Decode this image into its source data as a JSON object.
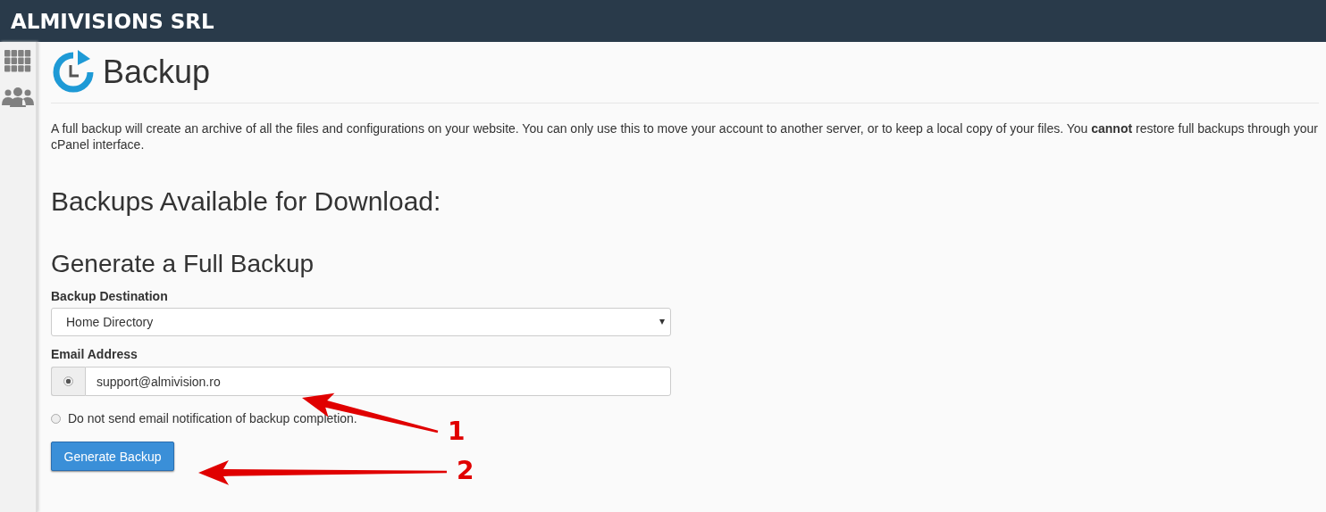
{
  "header": {
    "title": "ALMIVISIONS SRL"
  },
  "sidebar": {
    "items": [
      {
        "kind": "grid"
      },
      {
        "kind": "users"
      }
    ]
  },
  "page": {
    "title": "Backup",
    "description": "A full backup will create an archive of all the files and configurations on your website. You can only use this to move your account to another server, or to keep a local copy of your files. You **cannot** restore full backups through your cPanel interface."
  },
  "sections": [
    {
      "heading": "Backups Available for Download:"
    },
    {
      "heading": "Generate a Full Backup"
    }
  ],
  "form": {
    "destination": {
      "label": "Backup Destination",
      "value": "Home Directory"
    },
    "email": {
      "label": "Email Address",
      "value": "support@almivision.ro",
      "selected": true
    },
    "no_notify": {
      "label": "Do not send email notification of backup completion.",
      "selected": false
    },
    "button": "Generate Backup"
  },
  "annotations": [
    {
      "label": "1"
    },
    {
      "label": "2"
    }
  ]
}
